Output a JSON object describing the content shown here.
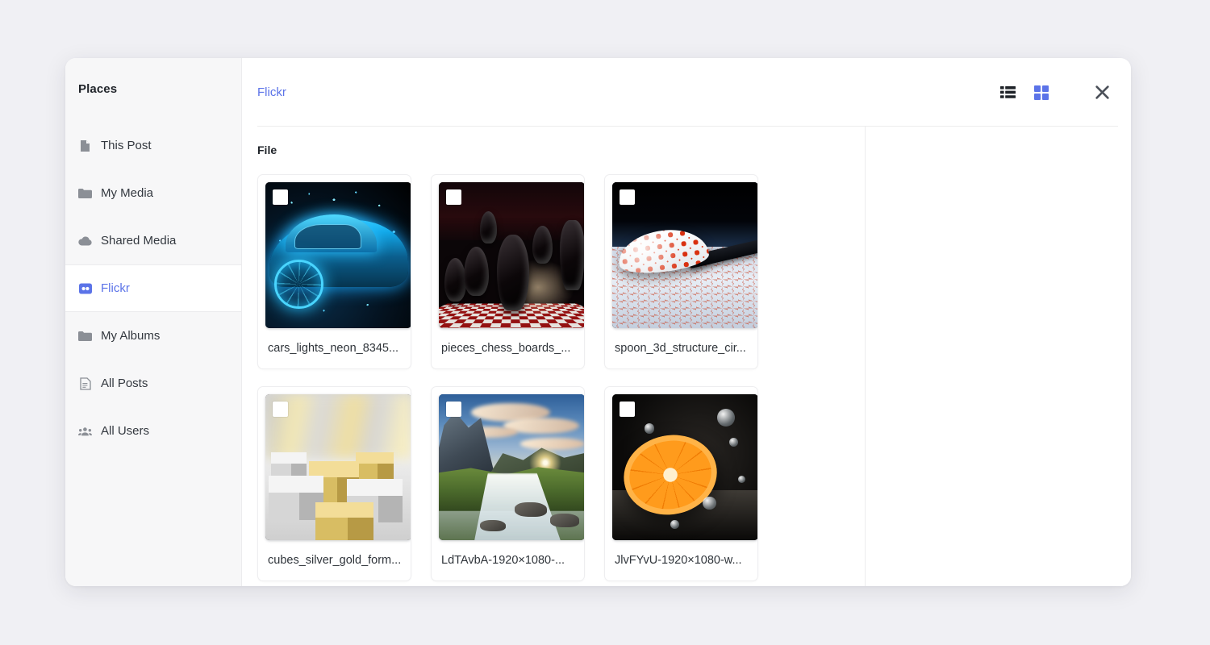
{
  "sidebar": {
    "title": "Places",
    "items": [
      {
        "label": "This Post",
        "icon": "document-icon",
        "active": false
      },
      {
        "label": "My Media",
        "icon": "folder-icon",
        "active": false
      },
      {
        "label": "Shared Media",
        "icon": "cloud-icon",
        "active": false
      },
      {
        "label": "Flickr",
        "icon": "flickr-icon",
        "active": true
      },
      {
        "label": "My Albums",
        "icon": "folder-icon",
        "active": false
      },
      {
        "label": "All Posts",
        "icon": "document-lines-icon",
        "active": false
      },
      {
        "label": "All Users",
        "icon": "users-icon",
        "active": false
      }
    ]
  },
  "header": {
    "breadcrumb": "Flickr",
    "list_view_label": "List view",
    "grid_view_label": "Grid view",
    "close_label": "Close"
  },
  "main": {
    "section_title": "File",
    "files": [
      {
        "name": "cars_lights_neon_8345...",
        "art": "art-car"
      },
      {
        "name": "pieces_chess_boards_...",
        "art": "art-chess"
      },
      {
        "name": "spoon_3d_structure_cir...",
        "art": "art-spoon"
      },
      {
        "name": "cubes_silver_gold_form...",
        "art": "art-cubes"
      },
      {
        "name": "LdTAvbA-1920×1080-...",
        "art": "art-falls"
      },
      {
        "name": "JlvFYvU-1920×1080-w...",
        "art": "art-orange"
      }
    ]
  },
  "colors": {
    "accent": "#5b73e8",
    "page_background": "#f0f0f4",
    "dialog_background": "#ffffff",
    "sidebar_background": "#f7f7f8",
    "text": "#33383f",
    "muted_icon": "#8b8f96",
    "divider": "#ececee"
  }
}
